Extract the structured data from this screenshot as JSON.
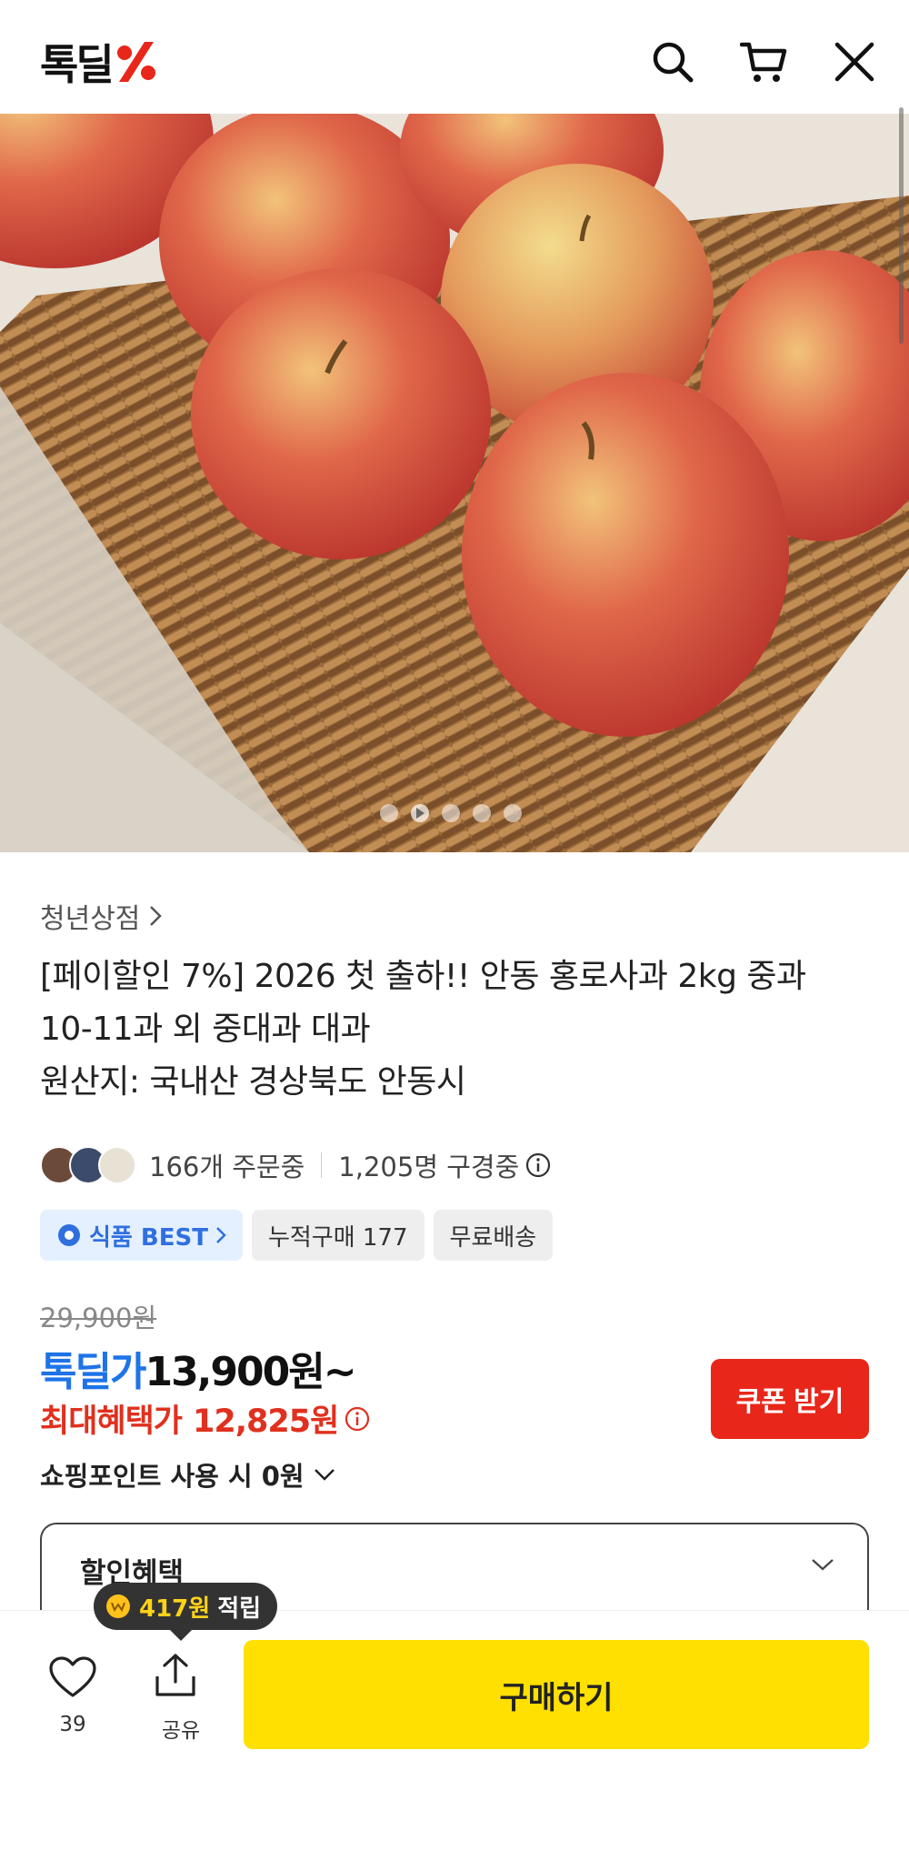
{
  "header": {
    "logo": "톡딜",
    "icons": [
      "search-icon",
      "cart-icon",
      "close-icon"
    ]
  },
  "hero": {
    "image": "apples in wicker basket",
    "carousel_dots": 5
  },
  "product": {
    "store_name": "청년상점",
    "title_line1": "[페이할인 7%] 2026 첫 출하!! 안동 홍로사과 2kg 중과",
    "title_line2": "10-11과 외 중대과 대과",
    "title_line3": "원산지: 국내산 경상북도 안동시",
    "orders": "166개 주문중",
    "viewers": "1,205명 구경중",
    "badges": {
      "best": "식품 BEST",
      "cumulative": "누적구매 177",
      "shipping": "무료배송"
    },
    "original_price": "29,900원",
    "deal_label": "톡딜가",
    "deal_price": "13,900원~",
    "max_benefit_label": "최대혜택가",
    "max_benefit_price": "12,825원",
    "points_text": "쇼핑포인트 사용 시 0원",
    "coupon_button": "쿠폰 받기",
    "discount_section": "할인혜택"
  },
  "bottom": {
    "like_count": "39",
    "share_label": "공유",
    "buy_button": "구매하기",
    "tip_amount": "417원",
    "tip_suffix": "적립"
  },
  "colors": {
    "deal_blue": "#1e73e8",
    "benefit_red": "#e0301e",
    "coupon_red": "#e8261a",
    "buy_yellow": "#ffe000"
  }
}
